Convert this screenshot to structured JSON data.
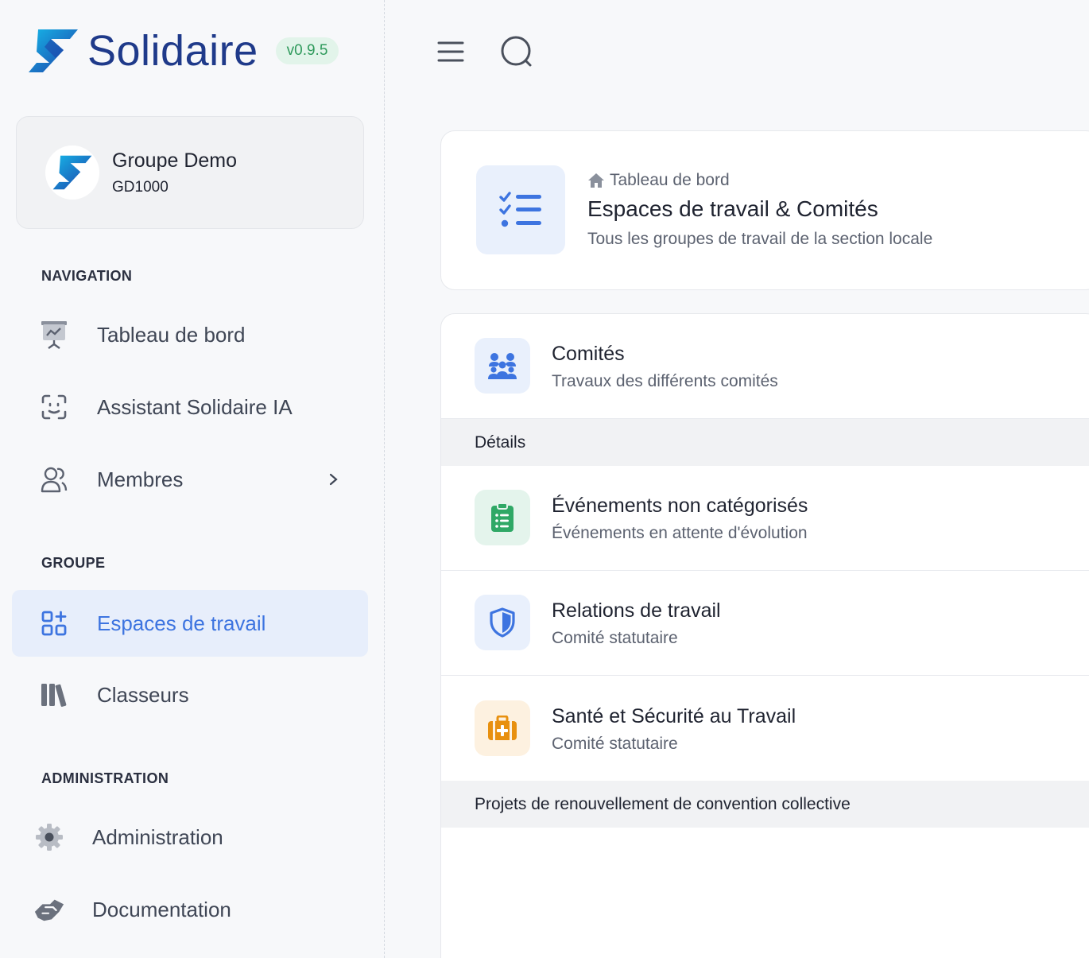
{
  "brand": {
    "name": "Solidaire",
    "version": "v0.9.5"
  },
  "group": {
    "name": "Groupe Demo",
    "code": "GD1000"
  },
  "sidebar": {
    "sections": {
      "navigation": "NAVIGATION",
      "groupe": "GROUPE",
      "administration": "ADMINISTRATION"
    },
    "items": [
      {
        "label": "Tableau de bord",
        "icon": "presentation-chart-icon"
      },
      {
        "label": "Assistant Solidaire IA",
        "icon": "face-scan-icon"
      },
      {
        "label": "Membres",
        "icon": "users-icon",
        "has_submenu": true
      },
      {
        "label": "Espaces de travail",
        "icon": "grid-plus-icon",
        "active": true
      },
      {
        "label": "Classeurs",
        "icon": "books-icon"
      },
      {
        "label": "Administration",
        "icon": "gear-icon"
      },
      {
        "label": "Documentation",
        "icon": "handshake-icon"
      }
    ]
  },
  "topbar": {
    "menu_icon": "hamburger-icon",
    "search_icon": "search-icon"
  },
  "header": {
    "breadcrumb": "Tableau de bord",
    "title": "Espaces de travail & Comités",
    "subtitle": "Tous les groupes de travail de la section locale"
  },
  "list": {
    "top_row": {
      "title": "Comités",
      "subtitle": "Travaux des différents comités"
    },
    "section_details": "Détails",
    "rows": [
      {
        "title": "Événements non catégorisés",
        "subtitle": "Événements en attente d'évolution",
        "color": "#2fa866"
      },
      {
        "title": "Relations de travail",
        "subtitle": "Comité statutaire",
        "color": "#3d74e0"
      },
      {
        "title": "Santé et Sécurité au Travail",
        "subtitle": "Comité statutaire",
        "color": "#e8900f"
      }
    ],
    "section_projects": "Projets de renouvellement de convention collective"
  },
  "colors": {
    "accent": "#3d74e0",
    "brand_dark": "#1f3a8a",
    "active_bg": "#e7eefb",
    "version_green": "#2f9a5c"
  }
}
